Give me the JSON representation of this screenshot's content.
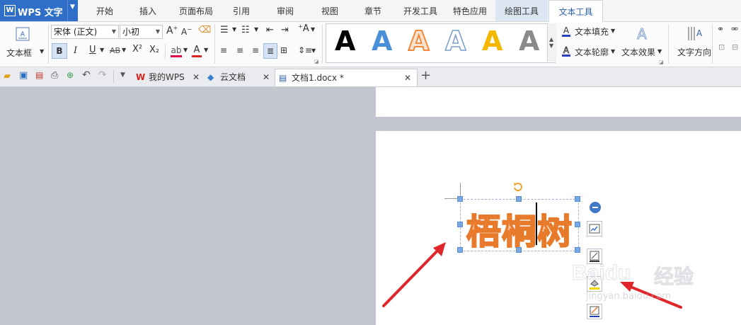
{
  "app": {
    "title": "WPS 文字",
    "logo": "W"
  },
  "menu": {
    "items": [
      "开始",
      "插入",
      "页面布局",
      "引用",
      "审阅",
      "视图",
      "章节",
      "开发工具",
      "特色应用",
      "绘图工具",
      "文本工具"
    ],
    "active": "文本工具"
  },
  "ribbon": {
    "textbox_label": "文本框",
    "font_name": "宋体 (正文)",
    "font_size": "小初",
    "bold": "B",
    "italic": "I",
    "underline": "U",
    "strike": "AB",
    "superscript": "X²",
    "subscript": "X₂",
    "text_fill": "文本填充",
    "text_outline": "文本轮廓",
    "text_effect": "文本效果",
    "text_direction": "文字方向",
    "style_letter": "A",
    "style_colors": [
      "#000000",
      "#4a90d9",
      "#f08a3c",
      "#ffffff",
      "#f5b800",
      "#8a8a8a"
    ]
  },
  "tabs": [
    {
      "label": "我的WPS"
    },
    {
      "label": "云文档"
    },
    {
      "label": "文档1.docx *"
    }
  ],
  "document": {
    "text": "梧桐树",
    "text_color": "#f08a3c"
  },
  "watermark": {
    "brand": "Baidu",
    "cn": "经验",
    "url": "jingyan.baidu.com"
  }
}
